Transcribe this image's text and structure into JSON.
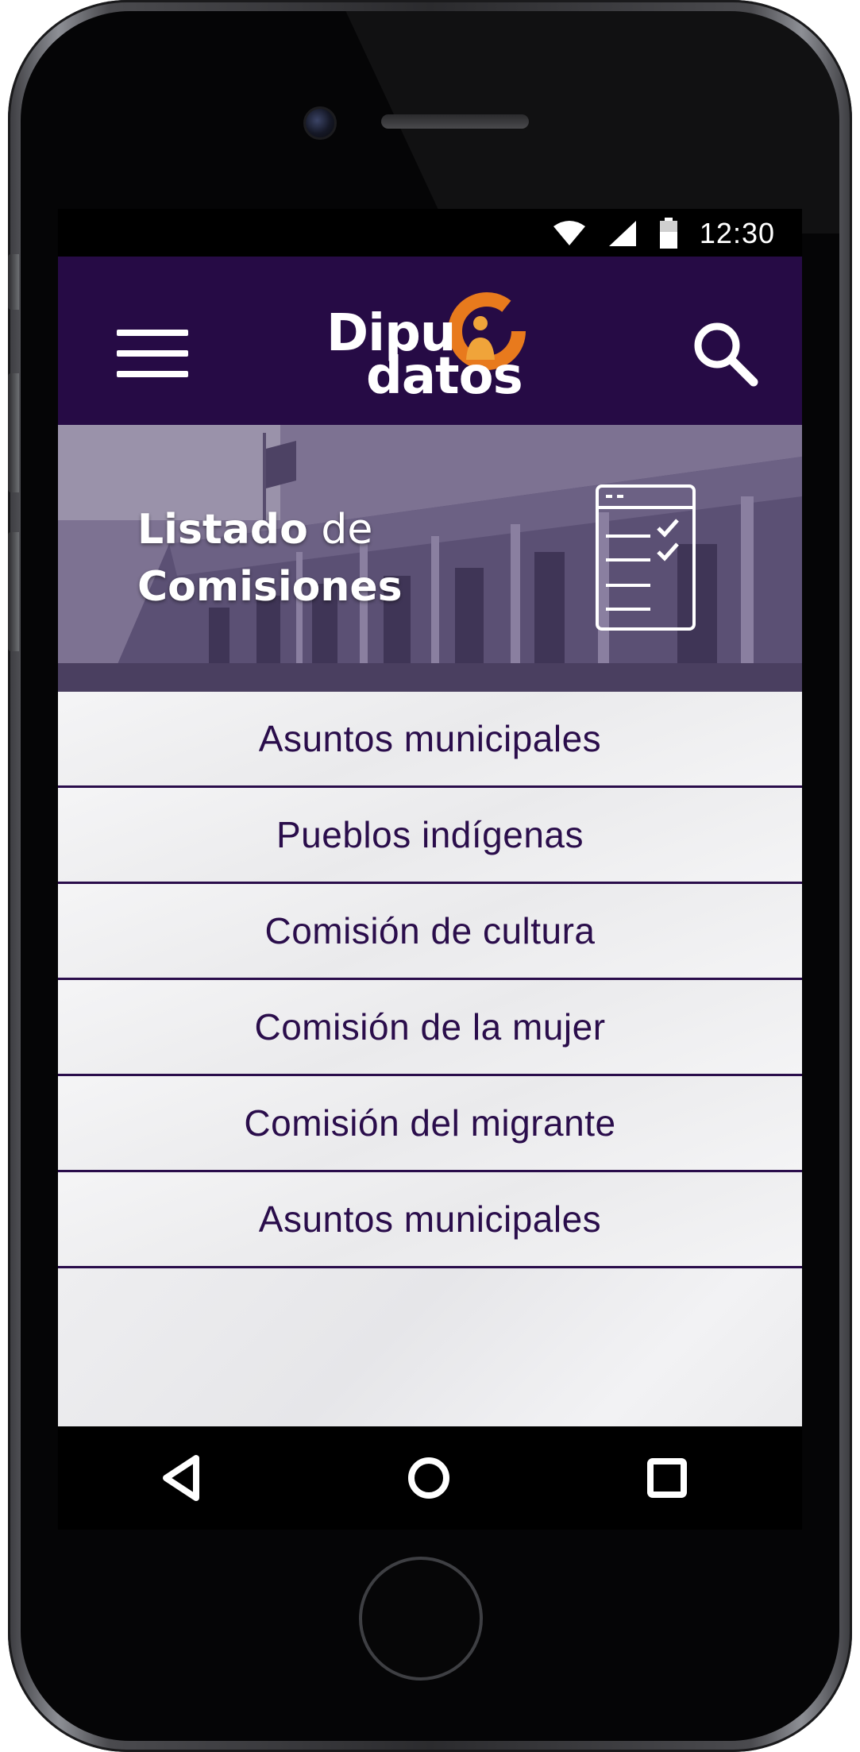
{
  "status_bar": {
    "time": "12:30",
    "icons": [
      "wifi-icon",
      "cellular-signal-icon",
      "battery-icon"
    ]
  },
  "app_bar": {
    "logo_line1": "Dipu",
    "logo_line2": "datos",
    "menu_icon": "hamburger-menu-icon",
    "search_icon": "search-icon"
  },
  "hero": {
    "title_part1": "Listado",
    "title_part2": "de",
    "title_part3": "Comisiones",
    "icon": "checklist-icon"
  },
  "commissions": [
    {
      "label": "Asuntos municipales"
    },
    {
      "label": "Pueblos indígenas"
    },
    {
      "label": "Comisión de cultura"
    },
    {
      "label": "Comisión de la mujer"
    },
    {
      "label": "Comisión del migrante"
    },
    {
      "label": "Asuntos municipales"
    }
  ],
  "nav_bar": {
    "back_icon": "back-triangle-icon",
    "home_icon": "home-circle-icon",
    "recents_icon": "recents-square-icon"
  },
  "colors": {
    "app_bar": "#260b45",
    "list_text": "#2a0d4b",
    "logo_accent": "#e87a1d",
    "screen_bg": "#efeff1"
  }
}
